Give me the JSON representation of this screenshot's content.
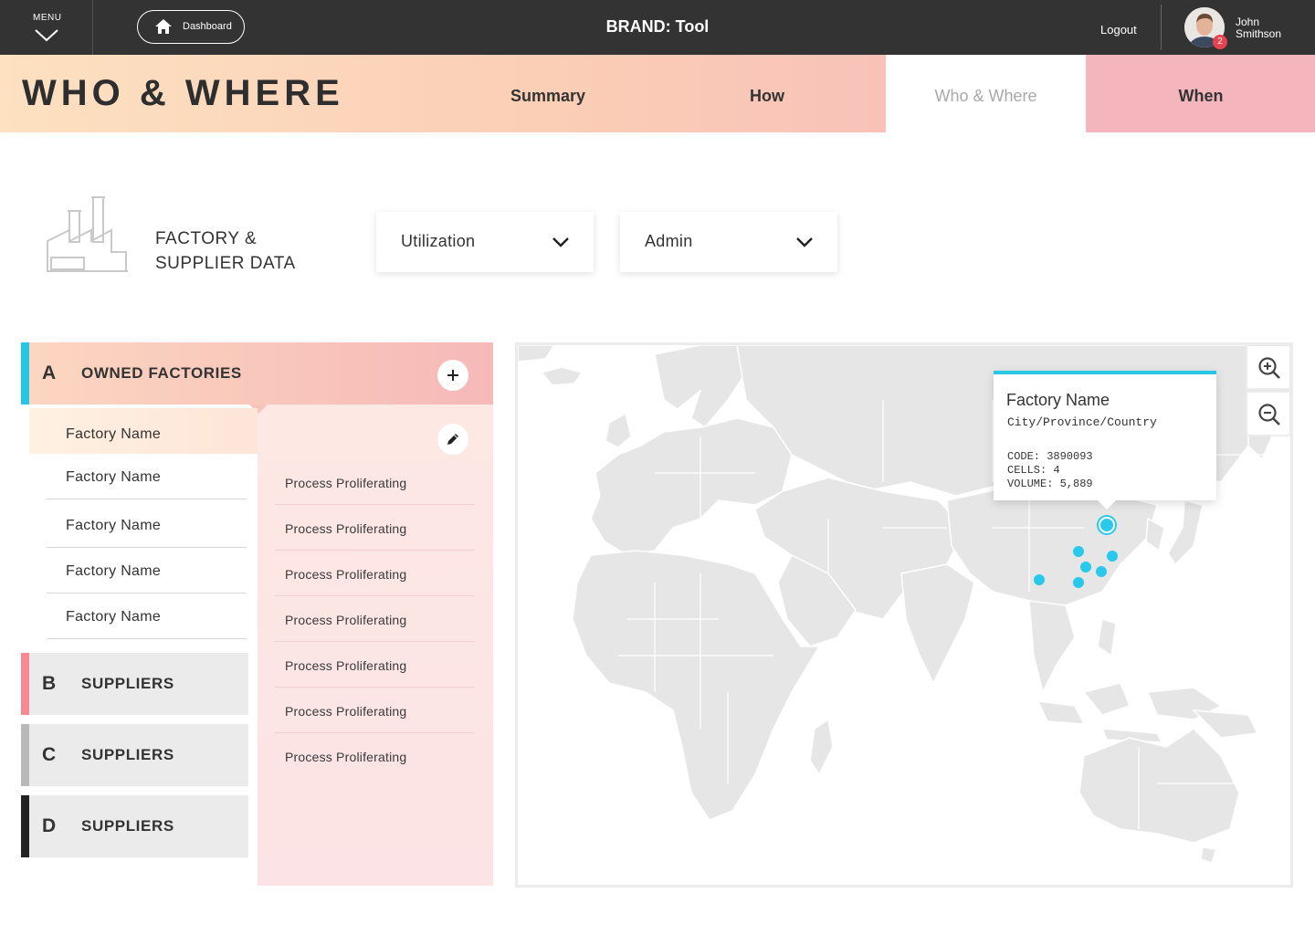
{
  "topbar": {
    "menu_label": "MENU",
    "dashboard_label": "Dashboard",
    "brand": "BRAND: Tool",
    "logout_label": "Logout",
    "notification_count": "2",
    "user_first": "John",
    "user_last": "Smithson"
  },
  "header": {
    "title": "WHO & WHERE",
    "tabs": [
      {
        "label": "Summary"
      },
      {
        "label": "How"
      },
      {
        "label": "Who & Where",
        "active": true
      },
      {
        "label": "When"
      }
    ]
  },
  "filters": {
    "section_label_line1": "FACTORY &",
    "section_label_line2": "SUPPLIER DATA",
    "selects": [
      {
        "value": "Utilization"
      },
      {
        "value": "Admin"
      }
    ]
  },
  "groups": [
    {
      "letter": "A",
      "name": "OWNED FACTORIES",
      "color": "#27c6e6"
    },
    {
      "letter": "B",
      "name": "SUPPLIERS",
      "color": "#f58a93"
    },
    {
      "letter": "C",
      "name": "SUPPLIERS",
      "color": "#b9b9b9"
    },
    {
      "letter": "D",
      "name": "SUPPLIERS",
      "color": "#222222"
    }
  ],
  "factories": [
    {
      "name": "Factory Name"
    },
    {
      "name": "Factory Name"
    },
    {
      "name": "Factory Name"
    },
    {
      "name": "Factory Name"
    },
    {
      "name": "Factory Name"
    }
  ],
  "processes": [
    {
      "label": "Process Proliferating"
    },
    {
      "label": "Process Proliferating"
    },
    {
      "label": "Process Proliferating"
    },
    {
      "label": "Process Proliferating"
    },
    {
      "label": "Process Proliferating"
    },
    {
      "label": "Process Proliferating"
    },
    {
      "label": "Process Proliferating"
    }
  ],
  "map": {
    "tooltip": {
      "name": "Factory Name",
      "location": "City/Province/Country",
      "code": "CODE: 3890093",
      "cells": "CELLS: 4",
      "volume": "VOLUME: 5,889"
    }
  },
  "colors": {
    "accent": "#27c6e6",
    "topbar": "#333333",
    "badge": "#e8414f"
  }
}
